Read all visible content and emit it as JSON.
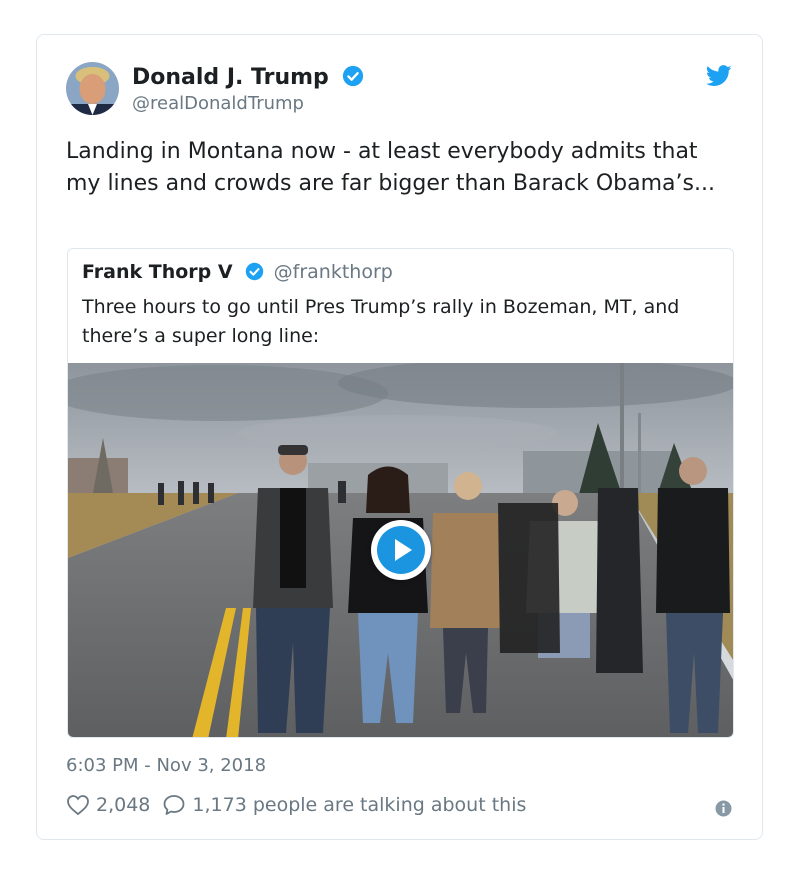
{
  "tweet": {
    "author": {
      "name": "Donald J. Trump",
      "handle": "@realDonaldTrump",
      "verified": true
    },
    "text": "Landing in Montana now - at least everybody admits that my lines and crowds are far bigger than Barack Obama’s...",
    "quoted": {
      "name": "Frank Thorp V",
      "handle": "@frankthorp",
      "verified": true,
      "text": "Three hours to go until Pres Trump’s rally in Bozeman, MT, and there’s a super long line:",
      "media": {
        "type": "video",
        "icon": "play-icon"
      }
    },
    "timestamp": "6:03 PM - Nov 3, 2018",
    "likes": "2,048",
    "talking": "1,173 people are talking about this"
  },
  "icons": {
    "verified": "verified-badge-icon",
    "brand": "twitter-bird-icon",
    "like": "heart-icon",
    "reply": "speech-bubble-icon",
    "info": "info-icon"
  },
  "colors": {
    "brand": "#1da1f2",
    "text": "#1c2022",
    "muted": "#697882",
    "border": "#e1e8ed",
    "play": "#1b95e0"
  }
}
